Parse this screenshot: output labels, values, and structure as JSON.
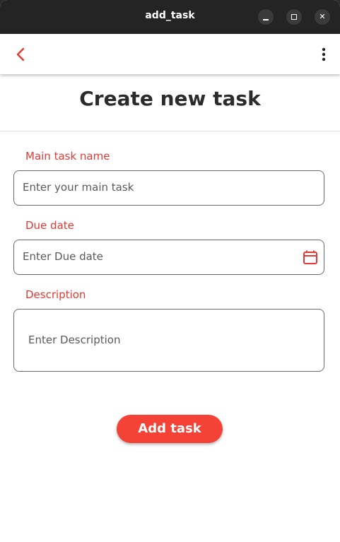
{
  "window": {
    "title": "add_task",
    "controls": [
      "minimize-icon",
      "maximize-icon",
      "close-icon"
    ],
    "close_glyph": "✕"
  },
  "appbar": {
    "back_icon": "chevron-left-icon",
    "menu_icon": "more-vertical-icon"
  },
  "page": {
    "title": "Create new task"
  },
  "form": {
    "main_task": {
      "label": "Main task name",
      "placeholder": "Enter your main task"
    },
    "due_date": {
      "label": "Due date",
      "placeholder": "Enter Due date",
      "icon": "calendar-icon"
    },
    "description": {
      "label": "Description",
      "placeholder": "Enter Description"
    },
    "submit_label": "Add task"
  },
  "colors": {
    "accent": "#f44336",
    "label": "#e53935",
    "titlebar": "#242424"
  }
}
